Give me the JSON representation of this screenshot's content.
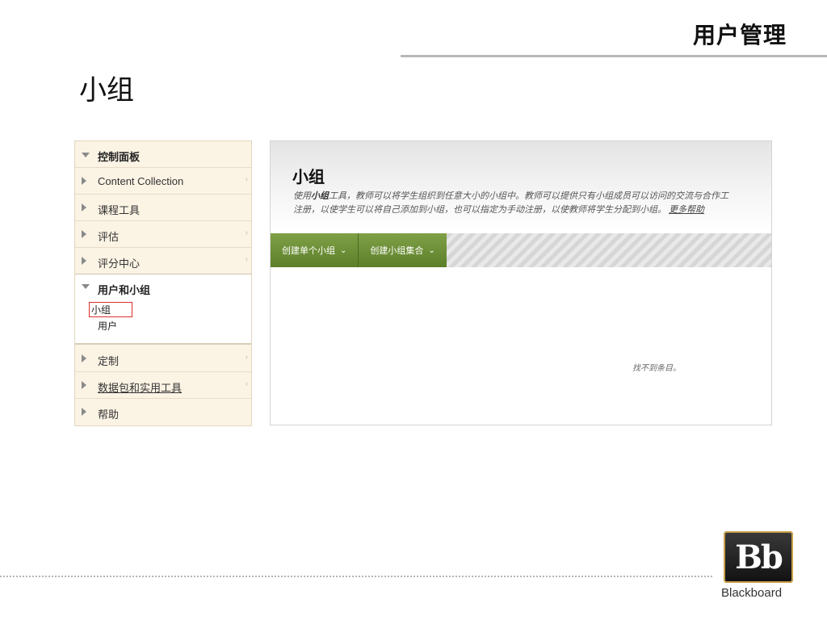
{
  "slide": {
    "title": "用户管理",
    "heading": "小组"
  },
  "control_panel": {
    "items": [
      {
        "label": "控制面板",
        "expanded": true,
        "bold": true
      },
      {
        "label": "Content Collection"
      },
      {
        "label": "课程工具"
      },
      {
        "label": "评估"
      },
      {
        "label": "评分中心"
      },
      {
        "label": "用户和小组",
        "expanded": true,
        "bold": true,
        "children": [
          {
            "label": "小组",
            "selected": true
          },
          {
            "label": "用户"
          }
        ]
      },
      {
        "label": "定制"
      },
      {
        "label": "数据包和实用工具",
        "link": true
      },
      {
        "label": "帮助"
      }
    ]
  },
  "content": {
    "title": "小组",
    "desc_prefix": "使用",
    "desc_tool": "小组",
    "desc_line1_rest": "工具，教师可以将学生组织到任意大小的小组中。教师可以提供只有小组成员可以访问的交流与合作工",
    "desc_line2": "注册，以使学生可以将自己添加到小组，也可以指定为手动注册，以使教师将学生分配到小组。",
    "more_help": "更多帮助",
    "actions": [
      "创建单个小组",
      "创建小组集合"
    ],
    "empty_message": "找不到条目。"
  },
  "branding": {
    "logo_letters": "Bb",
    "logo_name": "Blackboard"
  }
}
